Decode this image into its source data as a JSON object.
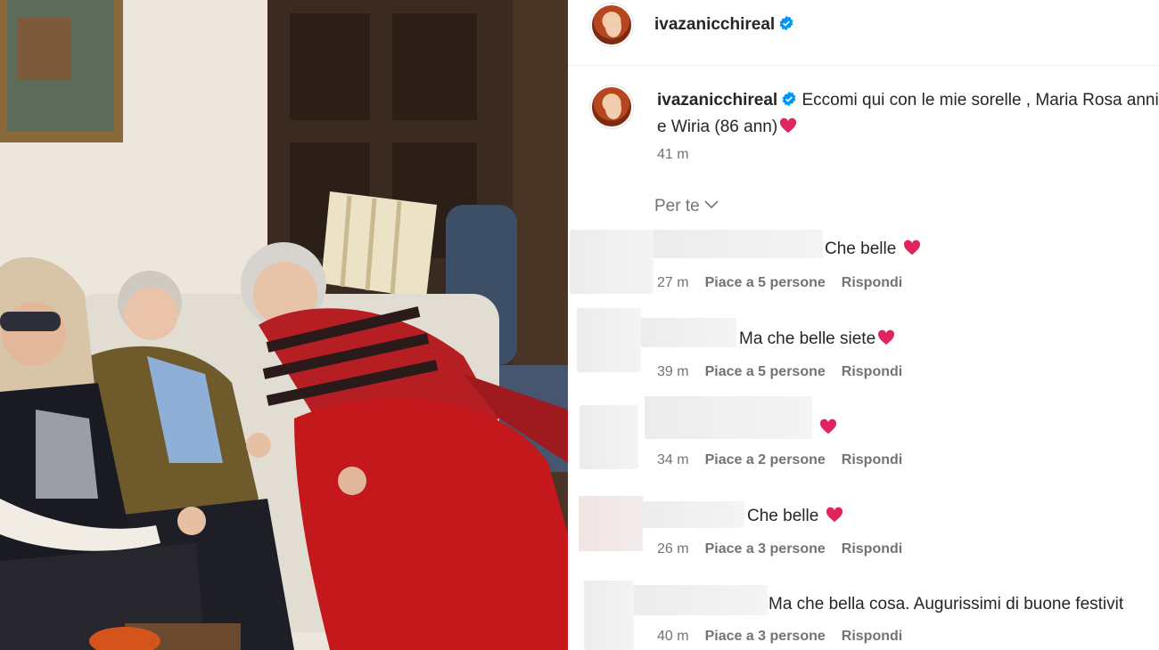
{
  "post": {
    "username": "ivazanicchireal",
    "caption": "Eccomi qui con le mie sorelle , Maria Rosa anni) e Wiria (86 ann)",
    "time": "41 m"
  },
  "filter": {
    "label": "Per te"
  },
  "comments": [
    {
      "text": "Che belle",
      "time": "27 m",
      "likes": "Piace a 5 persone",
      "reply": "Rispondi"
    },
    {
      "text": "Ma che belle siete",
      "time": "39 m",
      "likes": "Piace a 5 persone",
      "reply": "Rispondi"
    },
    {
      "text": "",
      "time": "34 m",
      "likes": "Piace a 2 persone",
      "reply": "Rispondi"
    },
    {
      "text": "Che belle",
      "time": "26 m",
      "likes": "Piace a 3 persone",
      "reply": "Rispondi"
    },
    {
      "text": "Ma che bella cosa. Augurissimi di buone festivit",
      "time": "40 m",
      "likes": "Piace a 3 persone",
      "reply": "Rispondi"
    }
  ],
  "icons": {
    "verified": "verified-badge-icon",
    "heart": "red-heart-emoji",
    "chevron": "chevron-down-icon"
  },
  "colors": {
    "verified": "#0095f6",
    "heart": "#e0245e",
    "muted": "#737373"
  }
}
